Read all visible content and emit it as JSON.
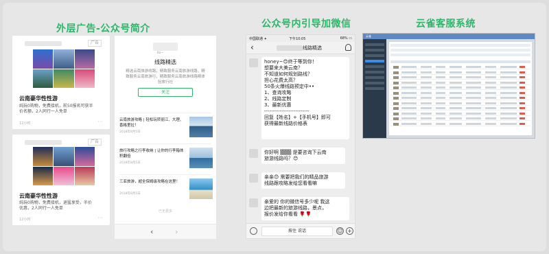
{
  "headings": {
    "ads": "外层广告-公众号简介",
    "chat": "公众号内引导加微信",
    "crm": "云雀客服系统"
  },
  "ad_cards": [
    {
      "tag": "广告",
      "title": "云南豪华性性游",
      "desc": "纯玩0购物，免费接机，前50报名可获半价名额，2人同行一人免单",
      "footer": "12小时",
      "more": "···"
    },
    {
      "tag": "广告",
      "title": "云南豪华性性游",
      "desc": "纯玩0购物，免费接机，退猛享受，半价优惠，2人同行一人免单",
      "footer": "12小时",
      "more": "···"
    }
  ],
  "profile": {
    "avatar_sub": "Ba—",
    "name": "线路精选",
    "intro": "精选云南旅游线路，精致服务云南旅游线路，精致服务云南旅游行，精致服务云南旅游线路精体验旅行社",
    "follow_label": "关注",
    "articles": [
      {
        "title": "云南旅游攻略 | 轻松玩转丽江、大理、香格里拉！",
        "date": "2018年8月5日"
      },
      {
        "title": "旅行攻略之行李收纳 | 让你的行李箱体积翻倍",
        "date": "2018年8月5日"
      },
      {
        "title": "三亚旅游，超全保姆级攻略在这里！",
        "date": "2018年8月5日"
      }
    ],
    "read_more": "已无更多"
  },
  "chat": {
    "carrier": "中国联通 ✦",
    "time": "下午10:05",
    "battery": "68% ▭",
    "title": "线路精选",
    "messages": [
      "honey~😊终于等到你！\n想要来大美云南？\n不知道如何规划路线？\n担心花费太高？\n50条火爆线路预定中••\n1、查询攻略\n2、线路定制\n3、最新优惠\n--------------------------\n回复【姓名】+【手机号】即可\n获得最新线路价格表",
      "你好啊 ▒▒▒ 是要咨询下云南\n旅游线路吗？😊",
      "亲亲😊 需要把我们的精品旅游\n线路跟攻略发给您看看嘛",
      "亲爱的 你的微信号多少呢 我这\n边把最新的旅游线路，景点，\n报价发给你看看 🌹🌹"
    ],
    "voice_label": "按住 说话",
    "emoji_icon": "☺",
    "plus_icon": "+"
  },
  "crm": {
    "app_title": "云雀"
  }
}
